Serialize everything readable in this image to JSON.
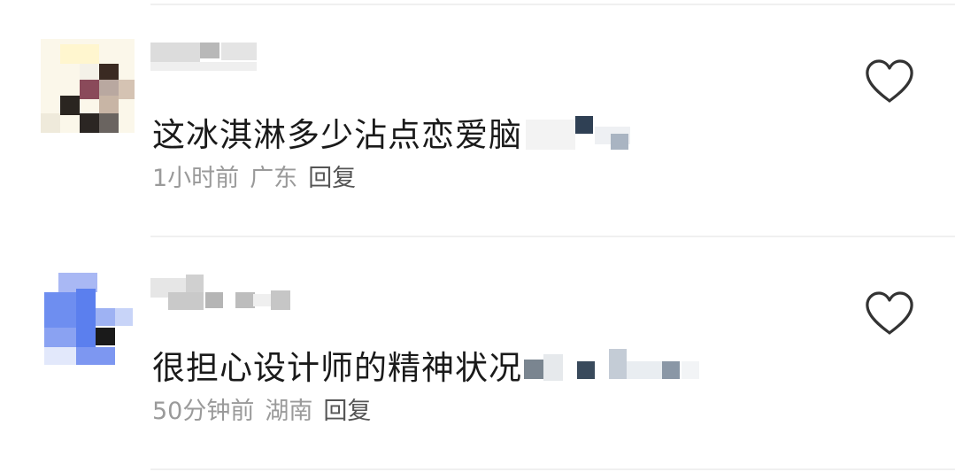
{
  "comments": [
    {
      "text": "这冰淇淋多少沾点恋爱脑",
      "time": "1小时前",
      "location": "广东",
      "reply_label": "回复"
    },
    {
      "text": "很担心设计师的精神状况",
      "time": "50分钟前",
      "location": "湖南",
      "reply_label": "回复"
    }
  ],
  "colors": {
    "text": "#1a1a1a",
    "meta": "#9a9a9a",
    "reply": "#555555",
    "icon_stroke": "#333333",
    "divider": "#f0f0f0"
  }
}
